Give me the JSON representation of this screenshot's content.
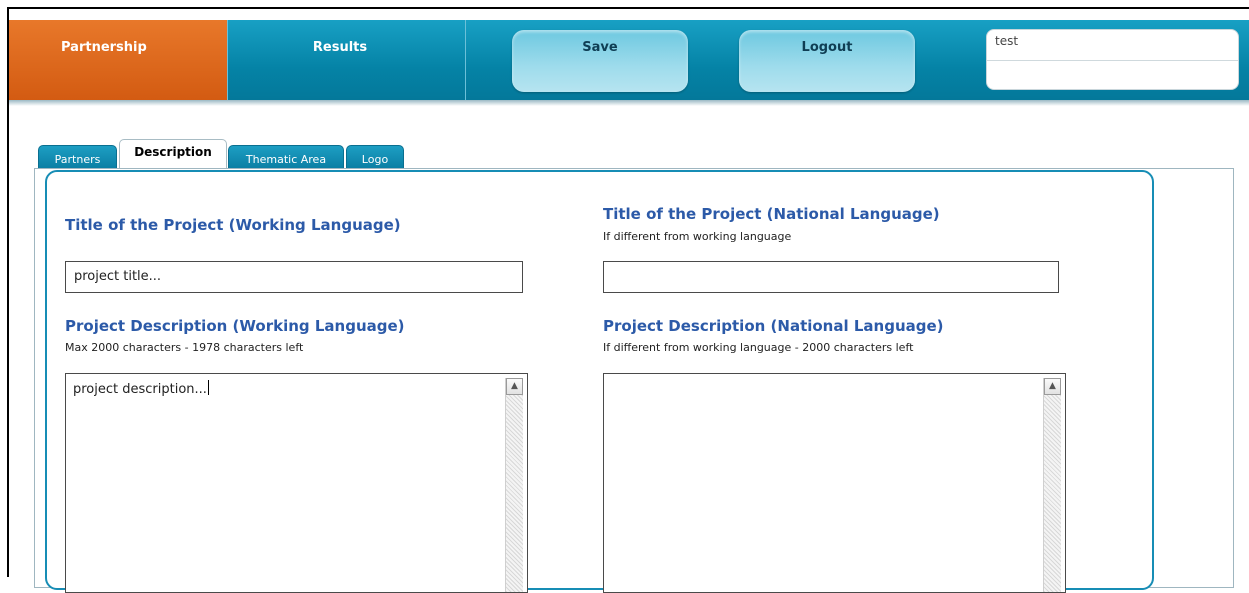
{
  "nav": {
    "partnership": "Partnership",
    "results": "Results"
  },
  "actions": {
    "save": "Save",
    "logout": "Logout"
  },
  "user": {
    "name": "test"
  },
  "tabs": [
    {
      "label": "Partners",
      "active": false
    },
    {
      "label": "Description",
      "active": true
    },
    {
      "label": "Thematic Area",
      "active": false
    },
    {
      "label": "Logo",
      "active": false
    }
  ],
  "form": {
    "title_working": {
      "label": "Title of the Project (Working Language)",
      "value": "project title..."
    },
    "title_national": {
      "label": "Title of the Project (National Language)",
      "hint": "If different from working language",
      "value": ""
    },
    "desc_working": {
      "label": "Project Description (Working Language)",
      "hint": "Max 2000 characters - 1978 characters left",
      "value": "project description..."
    },
    "desc_national": {
      "label": "Project Description (National Language)",
      "hint": "If different from working language - 2000 characters left",
      "value": ""
    }
  },
  "colors": {
    "accent_orange": "#d35b12",
    "nav_blue": "#0583a6",
    "label_blue": "#2c5aa8",
    "panel_border": "#178db5"
  }
}
